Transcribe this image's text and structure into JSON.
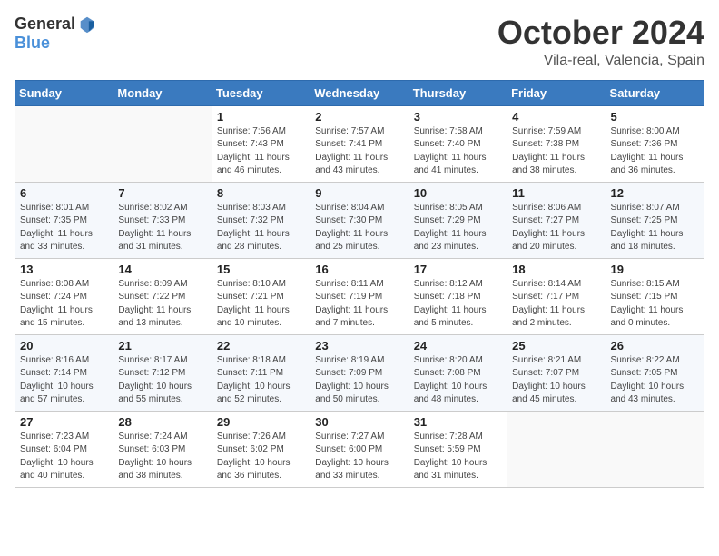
{
  "header": {
    "logo_general": "General",
    "logo_blue": "Blue",
    "month_title": "October 2024",
    "location": "Vila-real, Valencia, Spain"
  },
  "weekdays": [
    "Sunday",
    "Monday",
    "Tuesday",
    "Wednesday",
    "Thursday",
    "Friday",
    "Saturday"
  ],
  "weeks": [
    [
      {
        "day": "",
        "sunrise": "",
        "sunset": "",
        "daylight": ""
      },
      {
        "day": "",
        "sunrise": "",
        "sunset": "",
        "daylight": ""
      },
      {
        "day": "1",
        "sunrise": "Sunrise: 7:56 AM",
        "sunset": "Sunset: 7:43 PM",
        "daylight": "Daylight: 11 hours and 46 minutes."
      },
      {
        "day": "2",
        "sunrise": "Sunrise: 7:57 AM",
        "sunset": "Sunset: 7:41 PM",
        "daylight": "Daylight: 11 hours and 43 minutes."
      },
      {
        "day": "3",
        "sunrise": "Sunrise: 7:58 AM",
        "sunset": "Sunset: 7:40 PM",
        "daylight": "Daylight: 11 hours and 41 minutes."
      },
      {
        "day": "4",
        "sunrise": "Sunrise: 7:59 AM",
        "sunset": "Sunset: 7:38 PM",
        "daylight": "Daylight: 11 hours and 38 minutes."
      },
      {
        "day": "5",
        "sunrise": "Sunrise: 8:00 AM",
        "sunset": "Sunset: 7:36 PM",
        "daylight": "Daylight: 11 hours and 36 minutes."
      }
    ],
    [
      {
        "day": "6",
        "sunrise": "Sunrise: 8:01 AM",
        "sunset": "Sunset: 7:35 PM",
        "daylight": "Daylight: 11 hours and 33 minutes."
      },
      {
        "day": "7",
        "sunrise": "Sunrise: 8:02 AM",
        "sunset": "Sunset: 7:33 PM",
        "daylight": "Daylight: 11 hours and 31 minutes."
      },
      {
        "day": "8",
        "sunrise": "Sunrise: 8:03 AM",
        "sunset": "Sunset: 7:32 PM",
        "daylight": "Daylight: 11 hours and 28 minutes."
      },
      {
        "day": "9",
        "sunrise": "Sunrise: 8:04 AM",
        "sunset": "Sunset: 7:30 PM",
        "daylight": "Daylight: 11 hours and 25 minutes."
      },
      {
        "day": "10",
        "sunrise": "Sunrise: 8:05 AM",
        "sunset": "Sunset: 7:29 PM",
        "daylight": "Daylight: 11 hours and 23 minutes."
      },
      {
        "day": "11",
        "sunrise": "Sunrise: 8:06 AM",
        "sunset": "Sunset: 7:27 PM",
        "daylight": "Daylight: 11 hours and 20 minutes."
      },
      {
        "day": "12",
        "sunrise": "Sunrise: 8:07 AM",
        "sunset": "Sunset: 7:25 PM",
        "daylight": "Daylight: 11 hours and 18 minutes."
      }
    ],
    [
      {
        "day": "13",
        "sunrise": "Sunrise: 8:08 AM",
        "sunset": "Sunset: 7:24 PM",
        "daylight": "Daylight: 11 hours and 15 minutes."
      },
      {
        "day": "14",
        "sunrise": "Sunrise: 8:09 AM",
        "sunset": "Sunset: 7:22 PM",
        "daylight": "Daylight: 11 hours and 13 minutes."
      },
      {
        "day": "15",
        "sunrise": "Sunrise: 8:10 AM",
        "sunset": "Sunset: 7:21 PM",
        "daylight": "Daylight: 11 hours and 10 minutes."
      },
      {
        "day": "16",
        "sunrise": "Sunrise: 8:11 AM",
        "sunset": "Sunset: 7:19 PM",
        "daylight": "Daylight: 11 hours and 7 minutes."
      },
      {
        "day": "17",
        "sunrise": "Sunrise: 8:12 AM",
        "sunset": "Sunset: 7:18 PM",
        "daylight": "Daylight: 11 hours and 5 minutes."
      },
      {
        "day": "18",
        "sunrise": "Sunrise: 8:14 AM",
        "sunset": "Sunset: 7:17 PM",
        "daylight": "Daylight: 11 hours and 2 minutes."
      },
      {
        "day": "19",
        "sunrise": "Sunrise: 8:15 AM",
        "sunset": "Sunset: 7:15 PM",
        "daylight": "Daylight: 11 hours and 0 minutes."
      }
    ],
    [
      {
        "day": "20",
        "sunrise": "Sunrise: 8:16 AM",
        "sunset": "Sunset: 7:14 PM",
        "daylight": "Daylight: 10 hours and 57 minutes."
      },
      {
        "day": "21",
        "sunrise": "Sunrise: 8:17 AM",
        "sunset": "Sunset: 7:12 PM",
        "daylight": "Daylight: 10 hours and 55 minutes."
      },
      {
        "day": "22",
        "sunrise": "Sunrise: 8:18 AM",
        "sunset": "Sunset: 7:11 PM",
        "daylight": "Daylight: 10 hours and 52 minutes."
      },
      {
        "day": "23",
        "sunrise": "Sunrise: 8:19 AM",
        "sunset": "Sunset: 7:09 PM",
        "daylight": "Daylight: 10 hours and 50 minutes."
      },
      {
        "day": "24",
        "sunrise": "Sunrise: 8:20 AM",
        "sunset": "Sunset: 7:08 PM",
        "daylight": "Daylight: 10 hours and 48 minutes."
      },
      {
        "day": "25",
        "sunrise": "Sunrise: 8:21 AM",
        "sunset": "Sunset: 7:07 PM",
        "daylight": "Daylight: 10 hours and 45 minutes."
      },
      {
        "day": "26",
        "sunrise": "Sunrise: 8:22 AM",
        "sunset": "Sunset: 7:05 PM",
        "daylight": "Daylight: 10 hours and 43 minutes."
      }
    ],
    [
      {
        "day": "27",
        "sunrise": "Sunrise: 7:23 AM",
        "sunset": "Sunset: 6:04 PM",
        "daylight": "Daylight: 10 hours and 40 minutes."
      },
      {
        "day": "28",
        "sunrise": "Sunrise: 7:24 AM",
        "sunset": "Sunset: 6:03 PM",
        "daylight": "Daylight: 10 hours and 38 minutes."
      },
      {
        "day": "29",
        "sunrise": "Sunrise: 7:26 AM",
        "sunset": "Sunset: 6:02 PM",
        "daylight": "Daylight: 10 hours and 36 minutes."
      },
      {
        "day": "30",
        "sunrise": "Sunrise: 7:27 AM",
        "sunset": "Sunset: 6:00 PM",
        "daylight": "Daylight: 10 hours and 33 minutes."
      },
      {
        "day": "31",
        "sunrise": "Sunrise: 7:28 AM",
        "sunset": "Sunset: 5:59 PM",
        "daylight": "Daylight: 10 hours and 31 minutes."
      },
      {
        "day": "",
        "sunrise": "",
        "sunset": "",
        "daylight": ""
      },
      {
        "day": "",
        "sunrise": "",
        "sunset": "",
        "daylight": ""
      }
    ]
  ]
}
